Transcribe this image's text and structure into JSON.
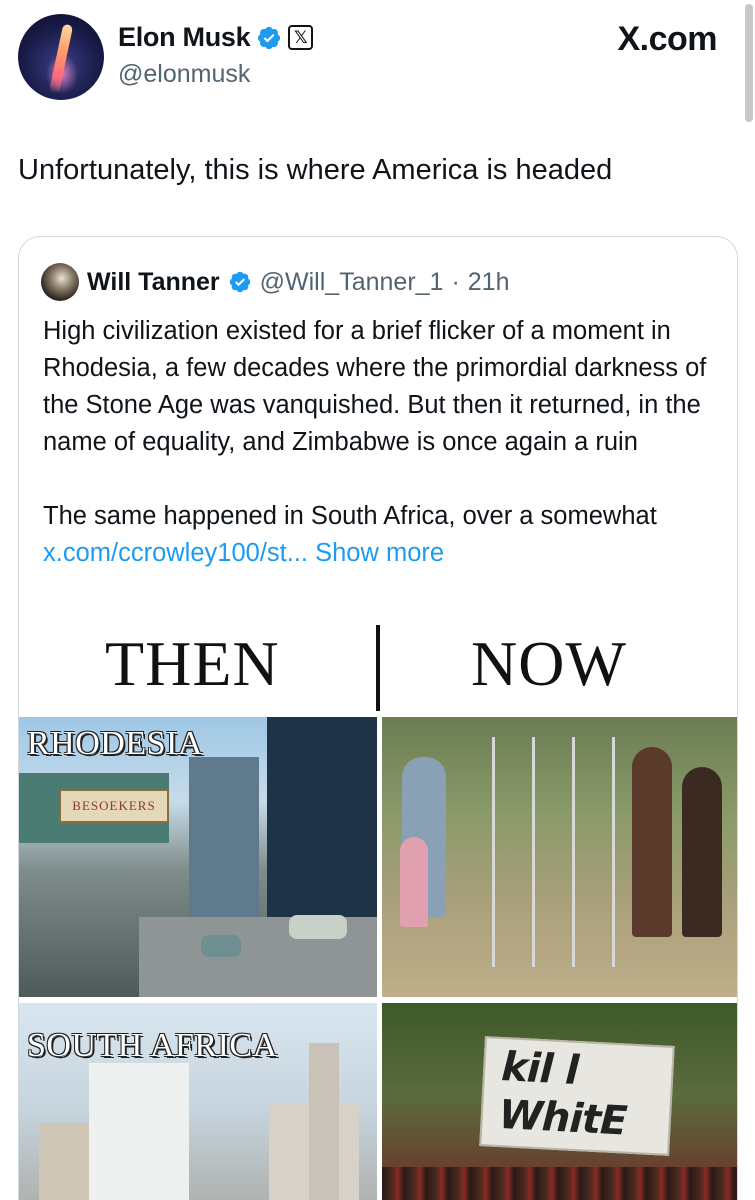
{
  "header": {
    "name": "Elon Musk",
    "handle": "@elonmusk",
    "site": "X.com",
    "x_badge": "𝕏"
  },
  "tweet": {
    "text": "Unfortunately, this is where America is headed"
  },
  "quote": {
    "name": "Will Tanner",
    "handle": "@Will_Tanner_1",
    "separator": "·",
    "time": "21h",
    "paragraph1": "High civilization existed for a brief flicker of a moment in Rhodesia, a few decades where the primordial darkness of the Stone Age was vanquished. But then it returned, in the name of equality, and Zimbabwe is once again a ruin",
    "paragraph2_prefix": "The same happened in South Africa, over a somewhat ",
    "paragraph2_link": "x.com/ccrowley100/st...",
    "show_more": "Show more"
  },
  "meme": {
    "then_label": "THEN",
    "now_label": "NOW",
    "rhodesia_label": "RHODESIA",
    "south_africa_label": "SOUTH AFRICA",
    "shop_sign": "BESOEKERS",
    "protest_sign_line1": "kil l",
    "protest_sign_line2": "WhitE"
  },
  "colors": {
    "text": "#0f1419",
    "secondary": "#536471",
    "link": "#1d9bf0",
    "verified": "#1d9bf0",
    "border": "#cfd9de"
  },
  "icons": {
    "verified": "verified-badge-icon",
    "x_logo": "x-logo-icon"
  }
}
